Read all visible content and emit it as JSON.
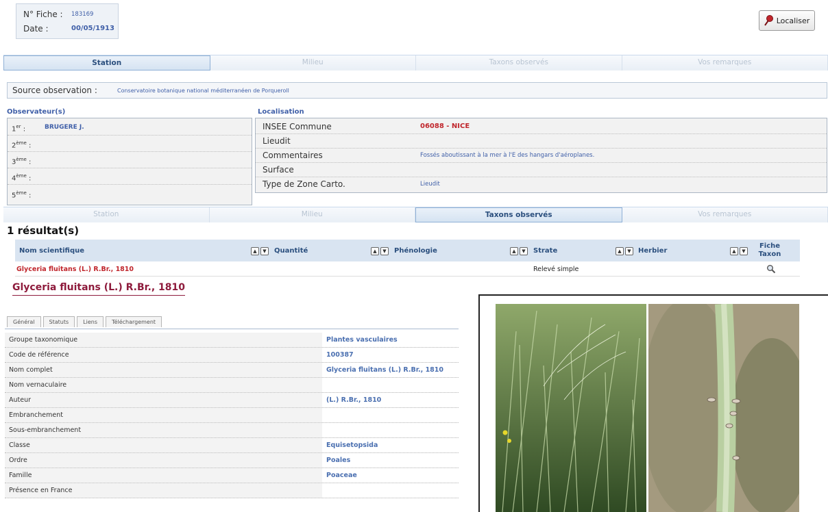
{
  "fiche": {
    "num_label": "N° Fiche :",
    "num_value": "183169",
    "date_label": "Date :",
    "date_value": "00/05/1913"
  },
  "localiser_label": "Localiser",
  "tabs_top": [
    "Station",
    "Milieu",
    "Taxons observés",
    "Vos remarques"
  ],
  "tabs_bottom": [
    "Station",
    "Milieu",
    "Taxons observés",
    "Vos remarques"
  ],
  "source": {
    "label": "Source observation :",
    "value": "Conservatoire botanique national méditerranéen de Porqueroll"
  },
  "observateurs": {
    "title": "Observateur(s)",
    "rows": [
      {
        "num": "1",
        "sup": "er",
        "value": "BRUGERE J."
      },
      {
        "num": "2",
        "sup": "ème",
        "value": ""
      },
      {
        "num": "3",
        "sup": "ème",
        "value": ""
      },
      {
        "num": "4",
        "sup": "ème",
        "value": ""
      },
      {
        "num": "5",
        "sup": "ème",
        "value": ""
      }
    ]
  },
  "localisation": {
    "title": "Localisation",
    "rows": [
      {
        "key": "INSEE Commune",
        "value": "06088 - NICE"
      },
      {
        "key": "Lieudit",
        "value": ""
      },
      {
        "key": "Commentaires",
        "value": "Fossés aboutissant à la mer à l'E des hangars d'aéroplanes."
      },
      {
        "key": "Surface",
        "value": ""
      },
      {
        "key": "Type de Zone Carto.",
        "value": "Lieudit"
      }
    ]
  },
  "results": {
    "count_label": "1 résultat(s)",
    "headers": [
      "Nom scientifique",
      "Quantité",
      "Phénologie",
      "Strate",
      "Herbier",
      "Fiche Taxon"
    ],
    "row": {
      "nom": "Glyceria fluitans (L.) R.Br., 1810",
      "quantite": "",
      "phenologie": "",
      "strate": "Relevé simple",
      "herbier": ""
    }
  },
  "taxon": {
    "title": "Glyceria fluitans (L.) R.Br., 1810",
    "subtabs": [
      "Général",
      "Statuts",
      "Liens",
      "Téléchargement"
    ],
    "details": [
      {
        "key": "Groupe taxonomique",
        "value": "Plantes vasculaires"
      },
      {
        "key": "Code de référence",
        "value": "100387"
      },
      {
        "key": "Nom complet",
        "value": "Glyceria fluitans (L.) R.Br., 1810"
      },
      {
        "key": "Nom vernaculaire",
        "value": ""
      },
      {
        "key": "Auteur",
        "value": "(L.) R.Br., 1810"
      },
      {
        "key": "Embranchement",
        "value": ""
      },
      {
        "key": "Sous-embranchement",
        "value": ""
      },
      {
        "key": "Classe",
        "value": "Equisetopsida"
      },
      {
        "key": "Ordre",
        "value": "Poales"
      },
      {
        "key": "Famille",
        "value": "Poaceae"
      },
      {
        "key": "Présence en France",
        "value": ""
      }
    ]
  },
  "icons": {
    "localiser": "map-pin-icon",
    "sort_up": "sort-up-icon",
    "sort_down": "sort-down-icon",
    "fiche": "magnifier-icon"
  },
  "colors": {
    "accent": "#3f5fa8",
    "red": "#c0262c",
    "taxon_title": "#8e1b3c"
  }
}
